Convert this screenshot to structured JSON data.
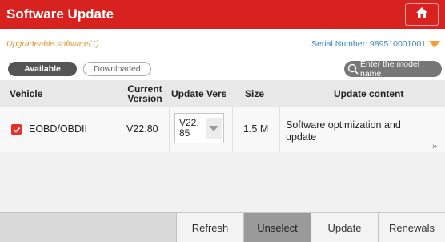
{
  "header": {
    "title": "Software Update",
    "home_icon": "home-icon",
    "colors": {
      "bar": "#d8221f"
    }
  },
  "info": {
    "upgradeable": "Upgradeable software(1)",
    "serial_label": "Serial Number:",
    "serial_value": "989510001001"
  },
  "tabs": {
    "available": "Available",
    "downloaded": "Downloaded"
  },
  "search": {
    "placeholder": "Enter the model name",
    "icon": "search-icon"
  },
  "table": {
    "headers": {
      "vehicle": "Vehicle",
      "current_version_1": "Current",
      "current_version_2": "Version",
      "update_version": "Update Versi",
      "size": "Size",
      "update_content": "Update content"
    },
    "rows": [
      {
        "checked": true,
        "vehicle": "EOBD/OBDII",
        "current_version": "V22.80",
        "update_version_line1": "V22.",
        "update_version_line2": "85",
        "size": "1.5 M",
        "update_content_line1": "Software optimization and",
        "update_content_line2": "update"
      }
    ]
  },
  "footer": {
    "refresh": "Refresh",
    "unselect": "Unselect",
    "update": "Update",
    "renewals": "Renewals"
  }
}
